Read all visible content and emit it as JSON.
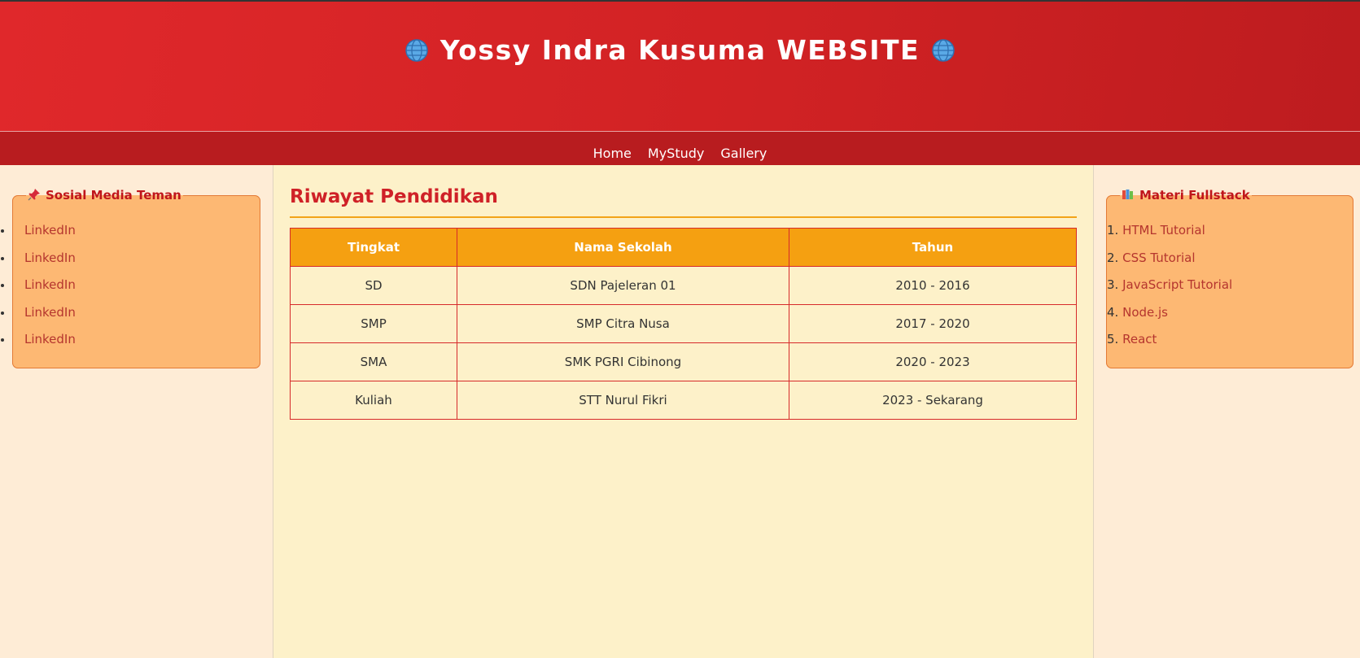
{
  "site": {
    "title": "Yossy Indra Kusuma WEBSITE",
    "title_icon": "globe-icon"
  },
  "nav": {
    "items": [
      {
        "label": "Home"
      },
      {
        "label": "MyStudy"
      },
      {
        "label": "Gallery"
      }
    ]
  },
  "left_box": {
    "legend": "Sosial Media Teman",
    "legend_icon": "pushpin-icon",
    "links": [
      {
        "label": "LinkedIn"
      },
      {
        "label": "LinkedIn"
      },
      {
        "label": "LinkedIn"
      },
      {
        "label": "LinkedIn"
      },
      {
        "label": "LinkedIn"
      }
    ]
  },
  "main": {
    "heading": "Riwayat Pendidikan",
    "table": {
      "headers": [
        "Tingkat",
        "Nama Sekolah",
        "Tahun"
      ],
      "rows": [
        [
          "SD",
          "SDN Pajeleran 01",
          "2010 - 2016"
        ],
        [
          "SMP",
          "SMP Citra Nusa",
          "2017 - 2020"
        ],
        [
          "SMA",
          "SMK PGRI Cibinong",
          "2020 - 2023"
        ],
        [
          "Kuliah",
          "STT Nurul Fikri",
          "2023 - Sekarang"
        ]
      ]
    }
  },
  "right_box": {
    "legend": "Materi Fullstack",
    "legend_icon": "books-icon",
    "items": [
      {
        "num": "1.",
        "label": "HTML Tutorial"
      },
      {
        "num": "2.",
        "label": "CSS Tutorial"
      },
      {
        "num": "3.",
        "label": "JavaScript Tutorial"
      },
      {
        "num": "4.",
        "label": "Node.js"
      },
      {
        "num": "5.",
        "label": "React"
      }
    ]
  },
  "colors": {
    "header_red": "#d12224",
    "nav_red": "#b81c1f",
    "table_header": "#f5a011",
    "box_orange": "#fdb873",
    "heading_red": "#cf2127",
    "content_bg": "#fdf1c9",
    "sidebar_bg": "#feecd6"
  }
}
